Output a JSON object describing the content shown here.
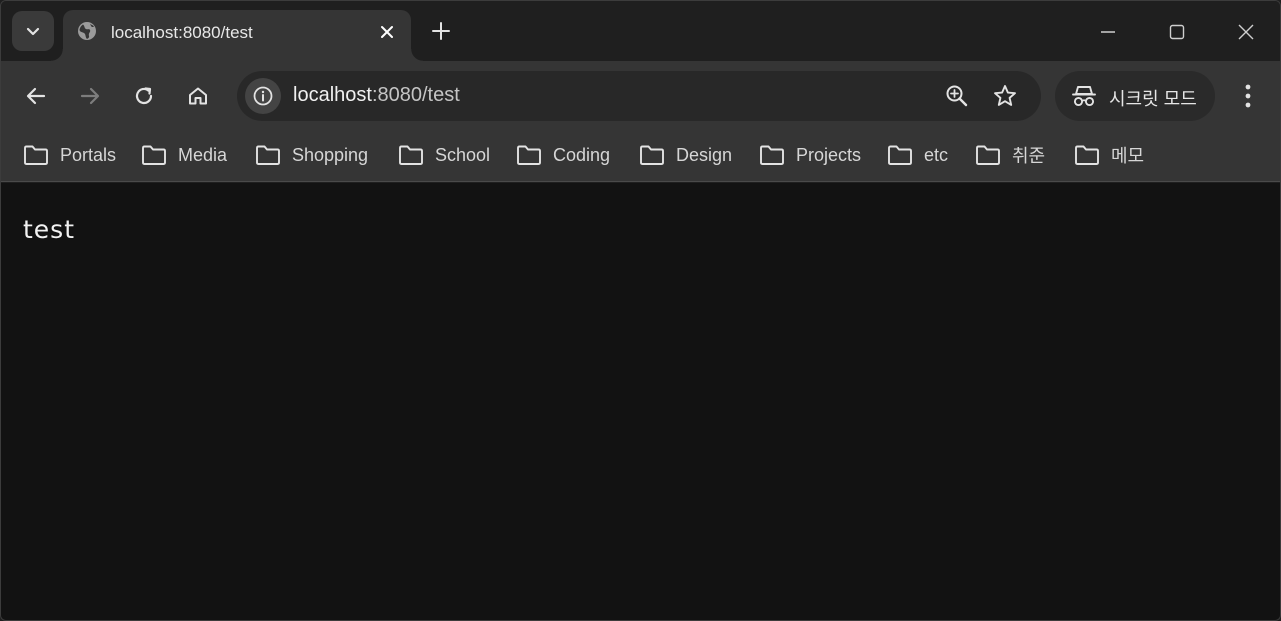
{
  "tab": {
    "title": "localhost:8080/test",
    "favicon": "globe-icon"
  },
  "address": {
    "host": "localhost",
    "path": ":8080/test"
  },
  "incognito": {
    "label": "시크릿 모드"
  },
  "bookmarks": [
    {
      "label": "Portals"
    },
    {
      "label": "Media"
    },
    {
      "label": "Shopping"
    },
    {
      "label": "School"
    },
    {
      "label": "Coding"
    },
    {
      "label": "Design"
    },
    {
      "label": "Projects"
    },
    {
      "label": "etc"
    },
    {
      "label": "취준"
    },
    {
      "label": "메모"
    }
  ],
  "page": {
    "text": "test"
  },
  "colors": {
    "background": "#1f1f1f",
    "toolbar": "#353535",
    "content": "#121212"
  }
}
